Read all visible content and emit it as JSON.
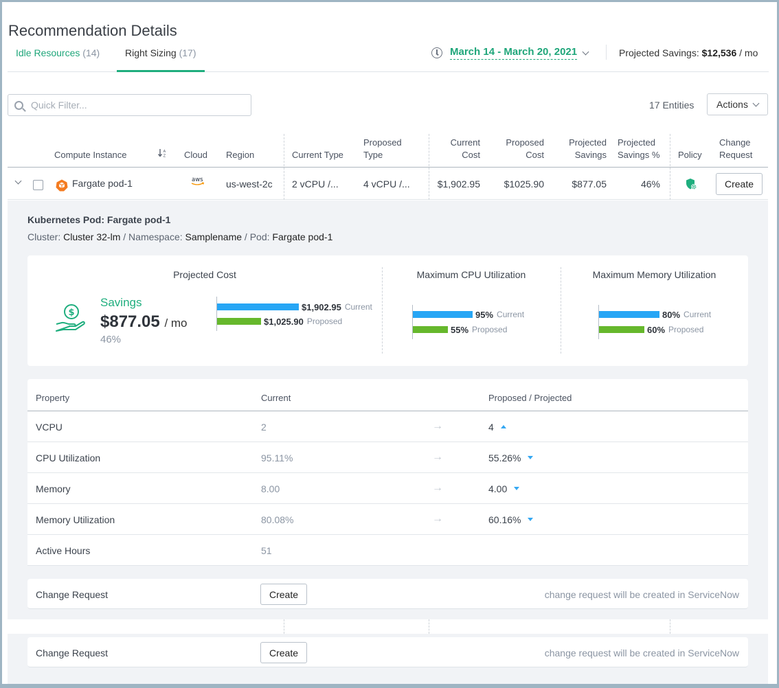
{
  "page": {
    "title": "Recommendation Details"
  },
  "tabs": [
    {
      "label": "Idle Resources",
      "count": "(14)",
      "active": false
    },
    {
      "label": "Right Sizing",
      "count": "(17)",
      "active": true
    }
  ],
  "header": {
    "date_range": "March 14 - March 20, 2021",
    "projected_savings_label": "Projected Savings:",
    "projected_savings_value": "$12,536",
    "projected_savings_unit": "/ mo"
  },
  "toolbar": {
    "filter_placeholder": "Quick Filter...",
    "filter_value": "",
    "entities": "17 Entities",
    "actions_label": "Actions"
  },
  "table": {
    "columns": {
      "compute_instance": "Compute Instance",
      "cloud": "Cloud",
      "region": "Region",
      "current_type": "Current Type",
      "proposed_type_1": "Proposed",
      "proposed_type_2": "Type",
      "current_cost_1": "Current",
      "current_cost_2": "Cost",
      "proposed_cost_1": "Proposed",
      "proposed_cost_2": "Cost",
      "projected_savings_1": "Projected",
      "projected_savings_2": "Savings",
      "projected_savings_pct_1": "Projected",
      "projected_savings_pct_2": "Savings %",
      "policy": "Policy",
      "change_request_1": "Change",
      "change_request_2": "Request"
    },
    "rows": [
      {
        "name": "Fargate pod-1",
        "cloud": "aws",
        "region": "us-west-2c",
        "current_type": "2 vCPU /...",
        "proposed_type": "4 vCPU /...",
        "current_cost": "$1,902.95",
        "proposed_cost": "$1025.90",
        "projected_savings": "$877.05",
        "projected_savings_pct": "46%",
        "create_label": "Create"
      }
    ]
  },
  "detail": {
    "title": "Kubernetes Pod: Fargate pod-1",
    "path": {
      "cluster_label": "Cluster:",
      "cluster": "Cluster 32-lm",
      "namespace_label": "/ Namespace:",
      "namespace": "Samplename",
      "pod_label": "/ Pod:",
      "pod": "Fargate pod-1"
    },
    "summary": {
      "projected_cost_title": "Projected Cost",
      "savings_label": "Savings",
      "savings_value": "$877.05",
      "savings_unit": "/ mo",
      "savings_pct": "46%",
      "cost_current": "$1,902.95",
      "cost_proposed": "$1,025.90",
      "cost_current_num": 1902.95,
      "cost_proposed_num": 1025.9,
      "cpu_title": "Maximum CPU Utilization",
      "cpu_current": "95%",
      "cpu_proposed": "55%",
      "cpu_current_num": 95,
      "cpu_proposed_num": 55,
      "mem_title": "Maximum Memory Utilization",
      "mem_current": "80%",
      "mem_proposed": "60%",
      "mem_current_num": 80,
      "mem_proposed_num": 60,
      "current_label": "Current",
      "proposed_label": "Proposed"
    },
    "properties": {
      "headers": {
        "property": "Property",
        "current": "Current",
        "proposed": "Proposed / Projected"
      },
      "rows": [
        {
          "name": "VCPU",
          "current": "2",
          "proposed": "4",
          "trend": "up"
        },
        {
          "name": "CPU Utilization",
          "current": "95.11%",
          "proposed": "55.26%",
          "trend": "down"
        },
        {
          "name": "Memory",
          "current": "8.00",
          "proposed": "4.00",
          "trend": "down"
        },
        {
          "name": "Memory Utilization",
          "current": "80.08%",
          "proposed": "60.16%",
          "trend": "down"
        },
        {
          "name": "Active Hours",
          "current": "51",
          "proposed": "",
          "trend": ""
        }
      ]
    },
    "change_request": {
      "label": "Change Request",
      "button": "Create",
      "note": "change request will be created in ServiceNow"
    }
  },
  "detail_2": {
    "change_request": {
      "label": "Change Request",
      "button": "Create",
      "note": "change request will be created in ServiceNow"
    }
  },
  "colors": {
    "accent_green": "#1fae7e",
    "bar_current": "#27a6f5",
    "bar_proposed": "#66b82c",
    "trend_blue": "#35a8f2",
    "pod_icon": "#f47b20"
  }
}
